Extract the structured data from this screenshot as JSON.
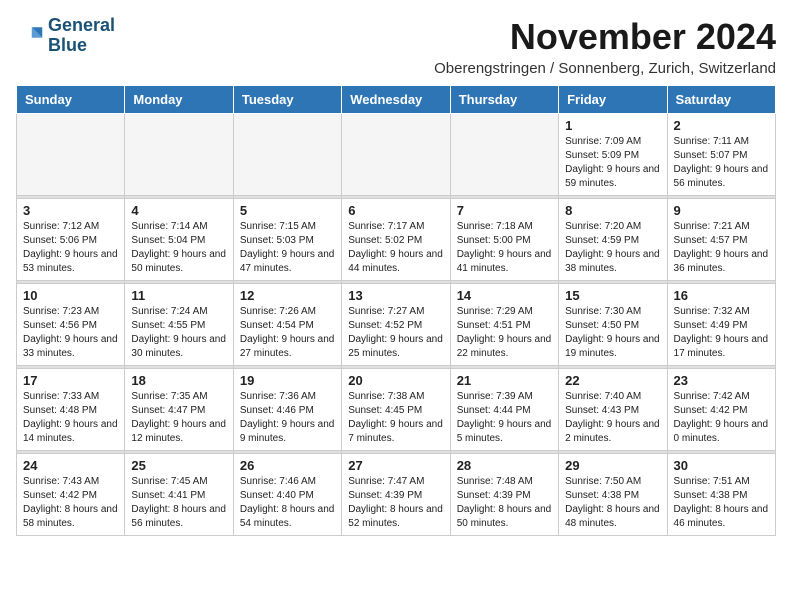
{
  "logo": {
    "line1": "General",
    "line2": "Blue"
  },
  "title": "November 2024",
  "subtitle": "Oberengstringen / Sonnenberg, Zurich, Switzerland",
  "days_of_week": [
    "Sunday",
    "Monday",
    "Tuesday",
    "Wednesday",
    "Thursday",
    "Friday",
    "Saturday"
  ],
  "weeks": [
    [
      {
        "day": "",
        "info": ""
      },
      {
        "day": "",
        "info": ""
      },
      {
        "day": "",
        "info": ""
      },
      {
        "day": "",
        "info": ""
      },
      {
        "day": "",
        "info": ""
      },
      {
        "day": "1",
        "info": "Sunrise: 7:09 AM\nSunset: 5:09 PM\nDaylight: 9 hours\nand 59 minutes."
      },
      {
        "day": "2",
        "info": "Sunrise: 7:11 AM\nSunset: 5:07 PM\nDaylight: 9 hours\nand 56 minutes."
      }
    ],
    [
      {
        "day": "3",
        "info": "Sunrise: 7:12 AM\nSunset: 5:06 PM\nDaylight: 9 hours\nand 53 minutes."
      },
      {
        "day": "4",
        "info": "Sunrise: 7:14 AM\nSunset: 5:04 PM\nDaylight: 9 hours\nand 50 minutes."
      },
      {
        "day": "5",
        "info": "Sunrise: 7:15 AM\nSunset: 5:03 PM\nDaylight: 9 hours\nand 47 minutes."
      },
      {
        "day": "6",
        "info": "Sunrise: 7:17 AM\nSunset: 5:02 PM\nDaylight: 9 hours\nand 44 minutes."
      },
      {
        "day": "7",
        "info": "Sunrise: 7:18 AM\nSunset: 5:00 PM\nDaylight: 9 hours\nand 41 minutes."
      },
      {
        "day": "8",
        "info": "Sunrise: 7:20 AM\nSunset: 4:59 PM\nDaylight: 9 hours\nand 38 minutes."
      },
      {
        "day": "9",
        "info": "Sunrise: 7:21 AM\nSunset: 4:57 PM\nDaylight: 9 hours\nand 36 minutes."
      }
    ],
    [
      {
        "day": "10",
        "info": "Sunrise: 7:23 AM\nSunset: 4:56 PM\nDaylight: 9 hours\nand 33 minutes."
      },
      {
        "day": "11",
        "info": "Sunrise: 7:24 AM\nSunset: 4:55 PM\nDaylight: 9 hours\nand 30 minutes."
      },
      {
        "day": "12",
        "info": "Sunrise: 7:26 AM\nSunset: 4:54 PM\nDaylight: 9 hours\nand 27 minutes."
      },
      {
        "day": "13",
        "info": "Sunrise: 7:27 AM\nSunset: 4:52 PM\nDaylight: 9 hours\nand 25 minutes."
      },
      {
        "day": "14",
        "info": "Sunrise: 7:29 AM\nSunset: 4:51 PM\nDaylight: 9 hours\nand 22 minutes."
      },
      {
        "day": "15",
        "info": "Sunrise: 7:30 AM\nSunset: 4:50 PM\nDaylight: 9 hours\nand 19 minutes."
      },
      {
        "day": "16",
        "info": "Sunrise: 7:32 AM\nSunset: 4:49 PM\nDaylight: 9 hours\nand 17 minutes."
      }
    ],
    [
      {
        "day": "17",
        "info": "Sunrise: 7:33 AM\nSunset: 4:48 PM\nDaylight: 9 hours\nand 14 minutes."
      },
      {
        "day": "18",
        "info": "Sunrise: 7:35 AM\nSunset: 4:47 PM\nDaylight: 9 hours\nand 12 minutes."
      },
      {
        "day": "19",
        "info": "Sunrise: 7:36 AM\nSunset: 4:46 PM\nDaylight: 9 hours\nand 9 minutes."
      },
      {
        "day": "20",
        "info": "Sunrise: 7:38 AM\nSunset: 4:45 PM\nDaylight: 9 hours\nand 7 minutes."
      },
      {
        "day": "21",
        "info": "Sunrise: 7:39 AM\nSunset: 4:44 PM\nDaylight: 9 hours\nand 5 minutes."
      },
      {
        "day": "22",
        "info": "Sunrise: 7:40 AM\nSunset: 4:43 PM\nDaylight: 9 hours\nand 2 minutes."
      },
      {
        "day": "23",
        "info": "Sunrise: 7:42 AM\nSunset: 4:42 PM\nDaylight: 9 hours\nand 0 minutes."
      }
    ],
    [
      {
        "day": "24",
        "info": "Sunrise: 7:43 AM\nSunset: 4:42 PM\nDaylight: 8 hours\nand 58 minutes."
      },
      {
        "day": "25",
        "info": "Sunrise: 7:45 AM\nSunset: 4:41 PM\nDaylight: 8 hours\nand 56 minutes."
      },
      {
        "day": "26",
        "info": "Sunrise: 7:46 AM\nSunset: 4:40 PM\nDaylight: 8 hours\nand 54 minutes."
      },
      {
        "day": "27",
        "info": "Sunrise: 7:47 AM\nSunset: 4:39 PM\nDaylight: 8 hours\nand 52 minutes."
      },
      {
        "day": "28",
        "info": "Sunrise: 7:48 AM\nSunset: 4:39 PM\nDaylight: 8 hours\nand 50 minutes."
      },
      {
        "day": "29",
        "info": "Sunrise: 7:50 AM\nSunset: 4:38 PM\nDaylight: 8 hours\nand 48 minutes."
      },
      {
        "day": "30",
        "info": "Sunrise: 7:51 AM\nSunset: 4:38 PM\nDaylight: 8 hours\nand 46 minutes."
      }
    ]
  ]
}
